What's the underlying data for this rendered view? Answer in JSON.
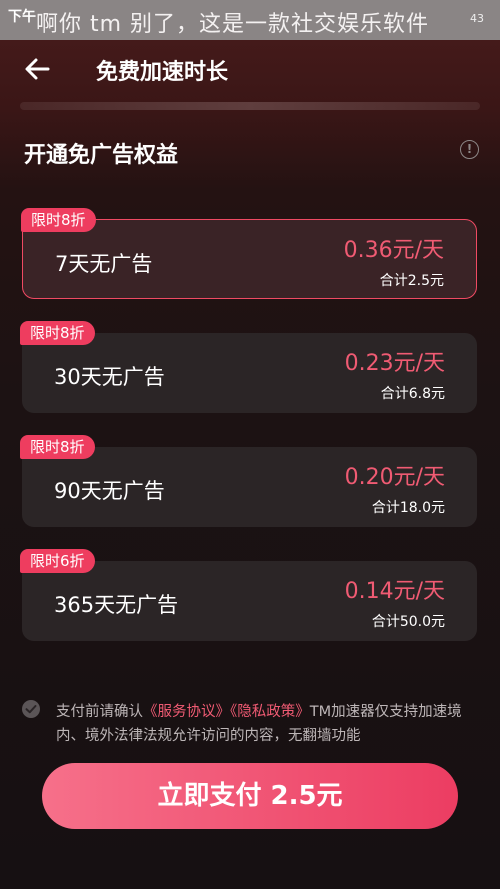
{
  "status_bar": {
    "time": "下午",
    "watermark": "啊你 tm 别了，这是一款社交娱乐软件",
    "signal": "43"
  },
  "header": {
    "back_icon": "back-arrow-icon",
    "title": "免费加速时长"
  },
  "section": {
    "title": "开通免广告权益",
    "info_icon": "info-icon"
  },
  "plans": [
    {
      "badge": "限时8折",
      "name": "7天无广告",
      "price": "0.36元/天",
      "total": "合计2.5元",
      "selected": true
    },
    {
      "badge": "限时8折",
      "name": "30天无广告",
      "price": "0.23元/天",
      "total": "合计6.8元",
      "selected": false
    },
    {
      "badge": "限时8折",
      "name": "90天无广告",
      "price": "0.20元/天",
      "total": "合计18.0元",
      "selected": false
    },
    {
      "badge": "限时6折",
      "name": "365天无广告",
      "price": "0.14元/天",
      "total": "合计50.0元",
      "selected": false
    }
  ],
  "agreement": {
    "prefix": "支付前请确认",
    "service_link": "《服务协议》",
    "privacy_link": "《隐私政策》",
    "suffix": "TM加速器仅支持加速境内、境外法律法规允许访问的内容，无翻墙功能"
  },
  "pay_button": {
    "label": "立即支付 2.5元"
  },
  "colors": {
    "accent": "#ee3d5f",
    "price": "#f05b73",
    "card_bg": "#2b2526"
  }
}
